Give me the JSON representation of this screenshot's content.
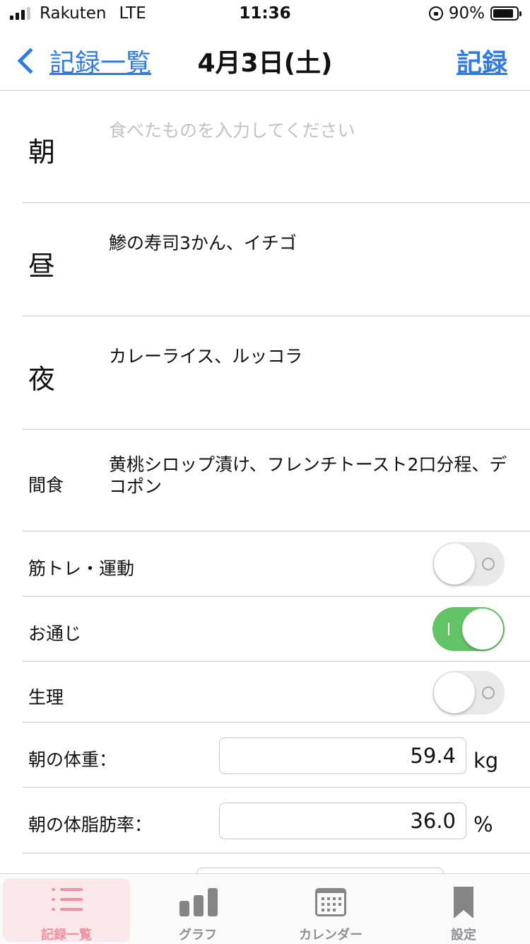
{
  "status_bar": {
    "carrier": "Rakuten",
    "network": "LTE",
    "time": "11:36",
    "battery": "90%"
  },
  "nav": {
    "back_label": "記録一覧",
    "title": "4月3日(土)",
    "action_label": "記録"
  },
  "meals": [
    {
      "label": "朝",
      "value": "",
      "placeholder": "食べたものを入力してください"
    },
    {
      "label": "昼",
      "value": "鯵の寿司3かん、イチゴ"
    },
    {
      "label": "夜",
      "value": "カレーライス、ルッコラ"
    },
    {
      "label": "間食",
      "value": "黄桃シロップ漬け、フレンチトースト2口分程、デコポン"
    }
  ],
  "toggles": [
    {
      "label": "筋トレ・運動",
      "on": false
    },
    {
      "label": "お通じ",
      "on": true
    },
    {
      "label": "生理",
      "on": false
    }
  ],
  "measurements": [
    {
      "label": "朝の体重：",
      "value": "59.4",
      "unit": "kg"
    },
    {
      "label": "朝の体脂肪率：",
      "value": "36.0",
      "unit": "%"
    }
  ],
  "tabs": [
    {
      "label": "記録一覧",
      "icon": "list-icon",
      "active": true
    },
    {
      "label": "グラフ",
      "icon": "bar-chart-icon",
      "active": false
    },
    {
      "label": "カレンダー",
      "icon": "calendar-icon",
      "active": false
    },
    {
      "label": "設定",
      "icon": "bookmark-icon",
      "active": false
    }
  ],
  "colors": {
    "accent": "#2f7be5",
    "toggle_on": "#63c466",
    "tab_active": "#f090a0"
  }
}
